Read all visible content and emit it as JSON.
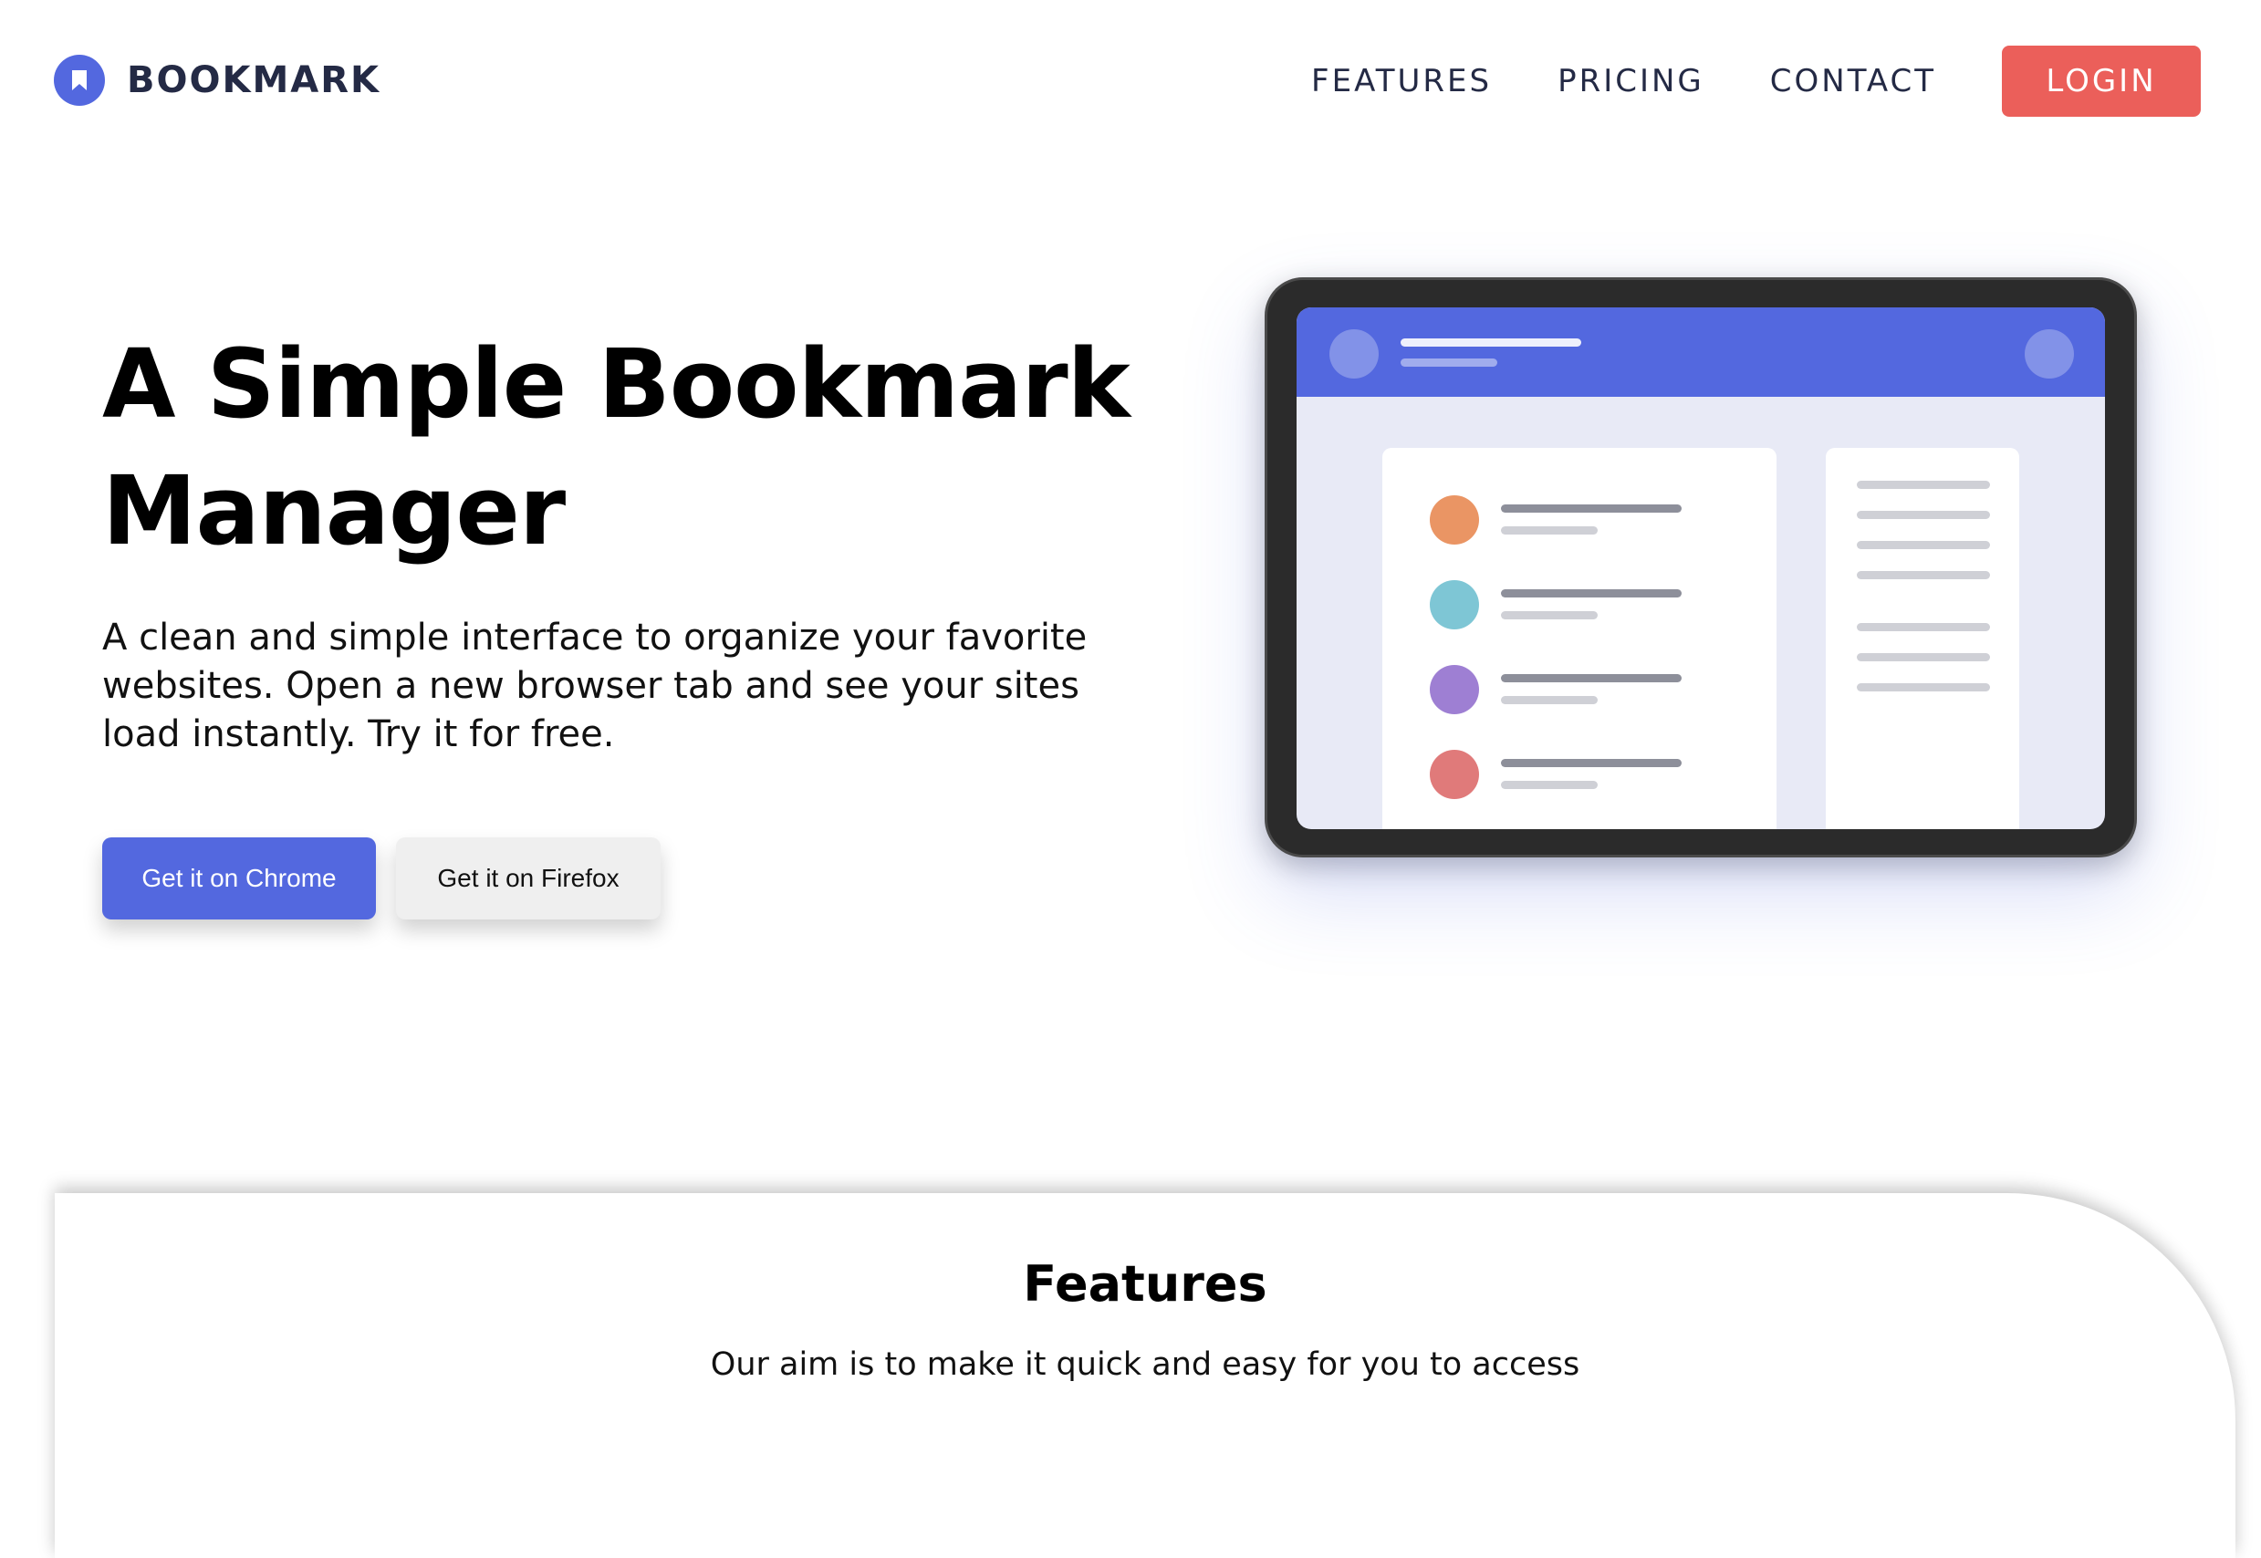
{
  "brand": {
    "name": "BOOKMARK",
    "icon": "bookmark-icon",
    "color": "#5368df"
  },
  "nav": {
    "links": [
      "FEATURES",
      "PRICING",
      "CONTACT"
    ],
    "login_label": "LOGIN",
    "login_color": "#eb5f5a"
  },
  "hero": {
    "title": "A Simple Bookmark Manager",
    "description": "A clean and simple interface to organize your favorite websites. Open a new browser tab and see your sites load instantly. Try it for free.",
    "chrome_label": "Get it on Chrome",
    "firefox_label": "Get it on Firefox"
  },
  "illustration": {
    "header_color": "#5368df",
    "item_colors": [
      "#ea9564",
      "#7ec6d5",
      "#9e7fd3",
      "#e07a7a"
    ]
  },
  "features": {
    "title": "Features",
    "text": "Our aim is to make it quick and easy for you to access"
  }
}
